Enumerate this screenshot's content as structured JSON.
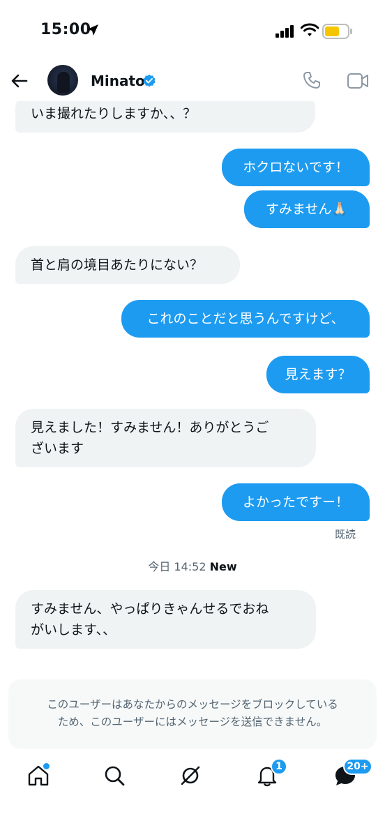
{
  "status_bar": {
    "time": "15:00"
  },
  "header": {
    "name": "Minato"
  },
  "messages": [
    {
      "side": "in",
      "text": "いま撮れたりしますか、、？"
    },
    {
      "side": "out",
      "text": "ホクロないです！"
    },
    {
      "side": "out",
      "text": "すみません🙏🏻"
    },
    {
      "side": "in",
      "text": "首と肩の境目あたりにない？"
    },
    {
      "side": "out",
      "text": "これのことだと思うんですけど、"
    },
    {
      "side": "out",
      "text": "見えます？"
    },
    {
      "side": "in",
      "line1": "見えました！すみません！ありがとうご",
      "line2": "ざいます"
    },
    {
      "side": "out",
      "text": "よかったですー！"
    },
    {
      "side": "in",
      "line1": "すみません、やっぱりきゃんせるでおね",
      "line2": "がいします、、"
    }
  ],
  "read_receipt": "既読",
  "day_separator": {
    "time": "今日 14:52",
    "new_label": "New"
  },
  "blocked_notice": {
    "line1": "このユーザーはあなたからのメッセージをブロックしている",
    "line2": "ため、このユーザーにはメッセージを送信できません。"
  },
  "tabbar": {
    "notifications_badge": "1",
    "messages_badge": "20+"
  },
  "colors": {
    "accent": "#1d9bf0",
    "incoming_bubble": "#eff3f4",
    "text": "#0f1419",
    "muted": "#536471"
  }
}
